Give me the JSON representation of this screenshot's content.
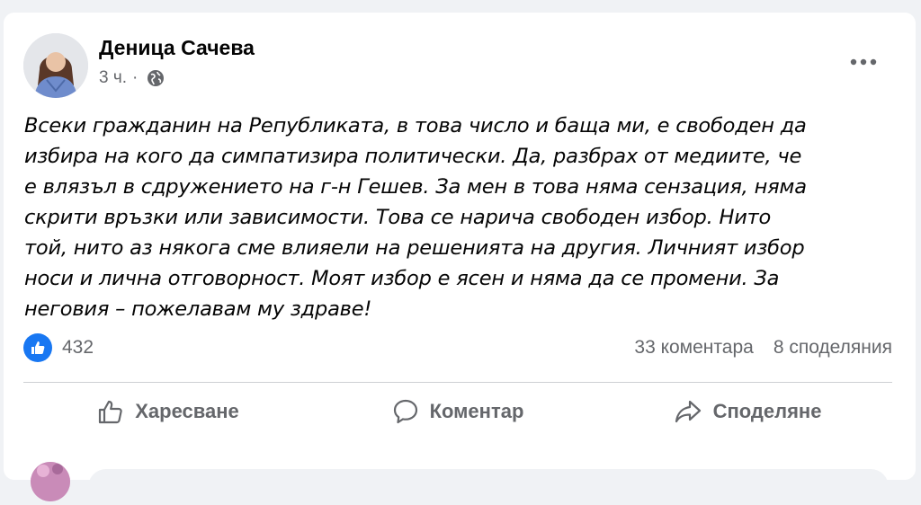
{
  "post": {
    "author": "Деница Сачева",
    "time": "3 ч.",
    "separator": "·",
    "privacy_icon": "globe-icon",
    "more_icon": "more-options-icon",
    "lines": [
      "Всеки гражданин на Републиката, в това число и баща ми, е свободен да",
      "избира на кого да симпатизира политически. Да, разбрах от медиите, че",
      "е влязъл в сдружението на г-н Гешев. За мен в това няма сензация, няма",
      "скрити връзки или зависимости. Това се нарича свободен избор. Нито",
      "той, нито аз някога сме влияели на решенията на другия. Личният избор",
      "носи и лична отговорност. Моят избор е ясен и няма да се промени. За",
      "неговия – пожелавам му здраве!"
    ]
  },
  "stats": {
    "likes": "432",
    "comments": "33 коментара",
    "shares": "8 споделяния"
  },
  "actions": {
    "like": "Харесване",
    "comment": "Коментар",
    "share": "Споделяне"
  },
  "colors": {
    "accent": "#1877f2",
    "secondary_text": "#65676b",
    "background": "#f0f2f5"
  }
}
